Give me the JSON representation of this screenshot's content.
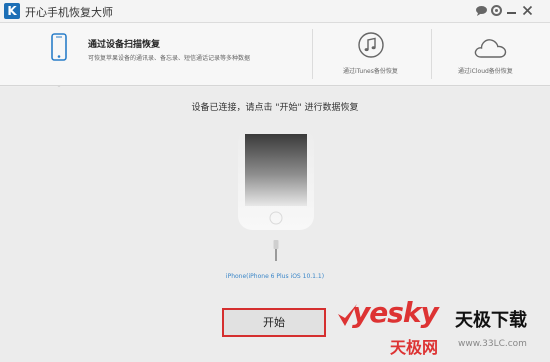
{
  "window": {
    "title": "开心手机恢复大师",
    "logo_letter": "K"
  },
  "tabs": [
    {
      "title": "通过设备扫描恢复",
      "description": "可恢复苹果设备的通讯录、备忘录、短信通话记录等多种数据",
      "icon": "phone-icon"
    },
    {
      "caption": "通过iTunes备份恢复",
      "icon": "music-note-icon"
    },
    {
      "caption": "通过iCloud备份恢复",
      "icon": "cloud-icon"
    }
  ],
  "main": {
    "prompt": "设备已连接，请点击 \"开始\" 进行数据恢复",
    "device_label": "iPhone(iPhone 6 Plus iOS 10.1.1)",
    "start_label": "开始"
  },
  "watermark": {
    "yesky": "yesky",
    "brand": "天极下载",
    "net": "天极网",
    "url": "www.33LC.com"
  },
  "colors": {
    "accent": "#1d6fb6",
    "highlight_border": "#d52f2f",
    "link": "#3a86c8"
  }
}
